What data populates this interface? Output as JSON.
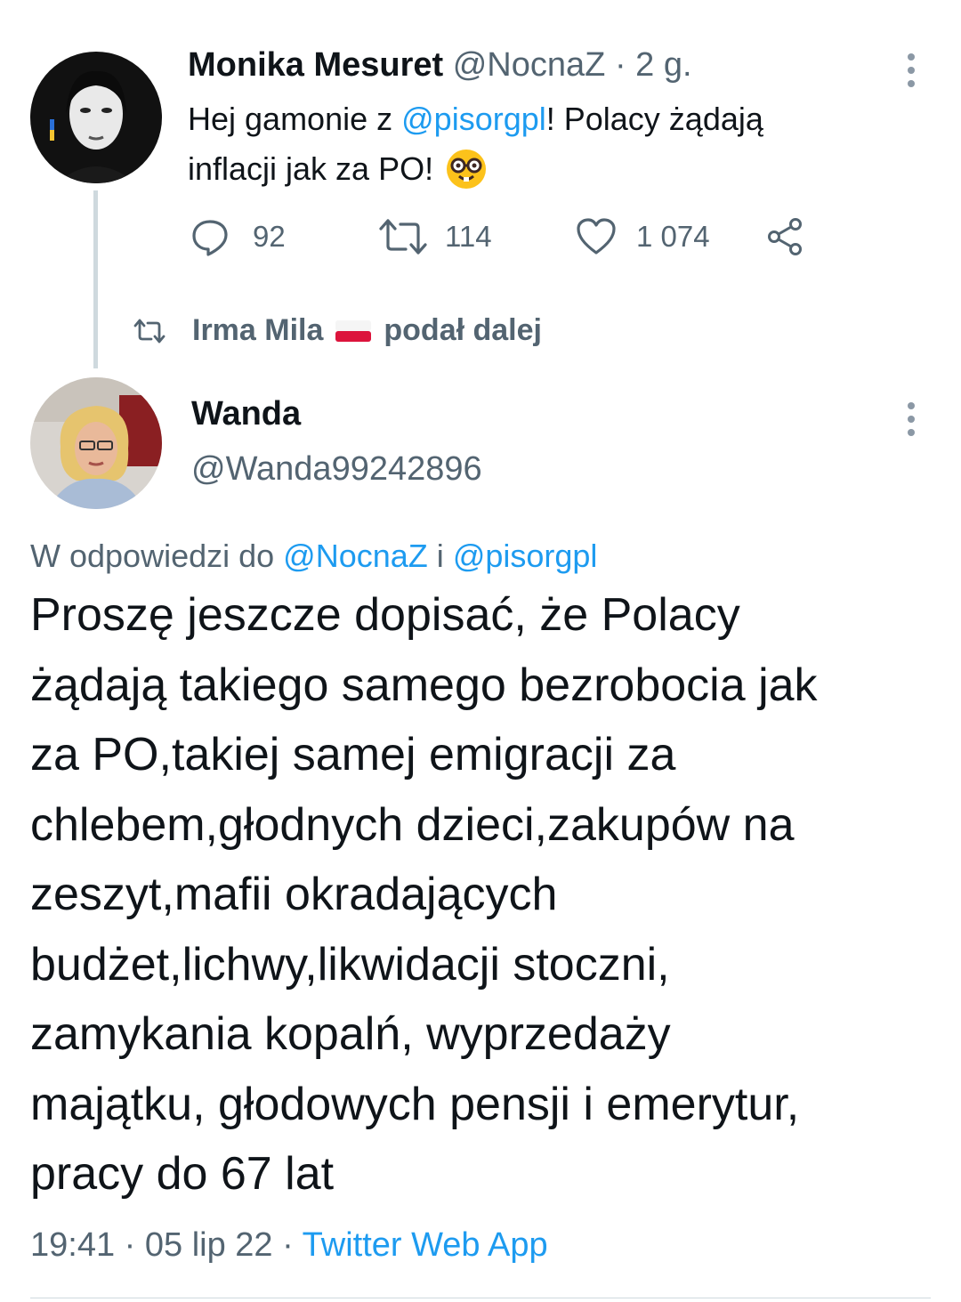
{
  "quoted_tweet": {
    "author_name": "Monika Mesuret",
    "author_handle": "@NocnaZ",
    "separator": "·",
    "time_ago": "2 g.",
    "text_before_mention": "Hej gamonie z ",
    "mention": "@pisorgpl",
    "text_after_mention_line1": "! Polacy żądają",
    "text_line2": "inflacji jak za PO!",
    "emoji": "nerd-face",
    "replies": "92",
    "retweets": "114",
    "likes": "1 074"
  },
  "retweet_banner": {
    "retweeter_name": "Irma Mila",
    "flag": "poland-flag",
    "action_text": "podał dalej"
  },
  "main_tweet": {
    "author_name": "Wanda",
    "author_handle": "@Wanda99242896",
    "reply_prefix": "W odpowiedzi do",
    "reply_to_1": "@NocnaZ",
    "reply_joiner": "i",
    "reply_to_2": "@pisorgpl",
    "body": "Proszę jeszcze dopisać, że Polacy\nżądają takiego samego bezrobocia jak\nza PO,takiej samej emigracji za\nchlebem,głodnych dzieci,zakupów na\nzeszyt,mafii okradających\nbudżet,lichwy,likwidacji stoczni,\nzamykania kopalń, wyprzedaży\nmajątku, głodowych pensji i emerytur,\npracy do 67 lat",
    "time": "19:41",
    "dot1": "·",
    "date": "05 lip 22",
    "dot2": "·",
    "source": "Twitter Web App"
  },
  "colors": {
    "accent": "#1d9bf0",
    "text": "#0f1419",
    "muted": "#536471",
    "line": "#cfd9de"
  }
}
